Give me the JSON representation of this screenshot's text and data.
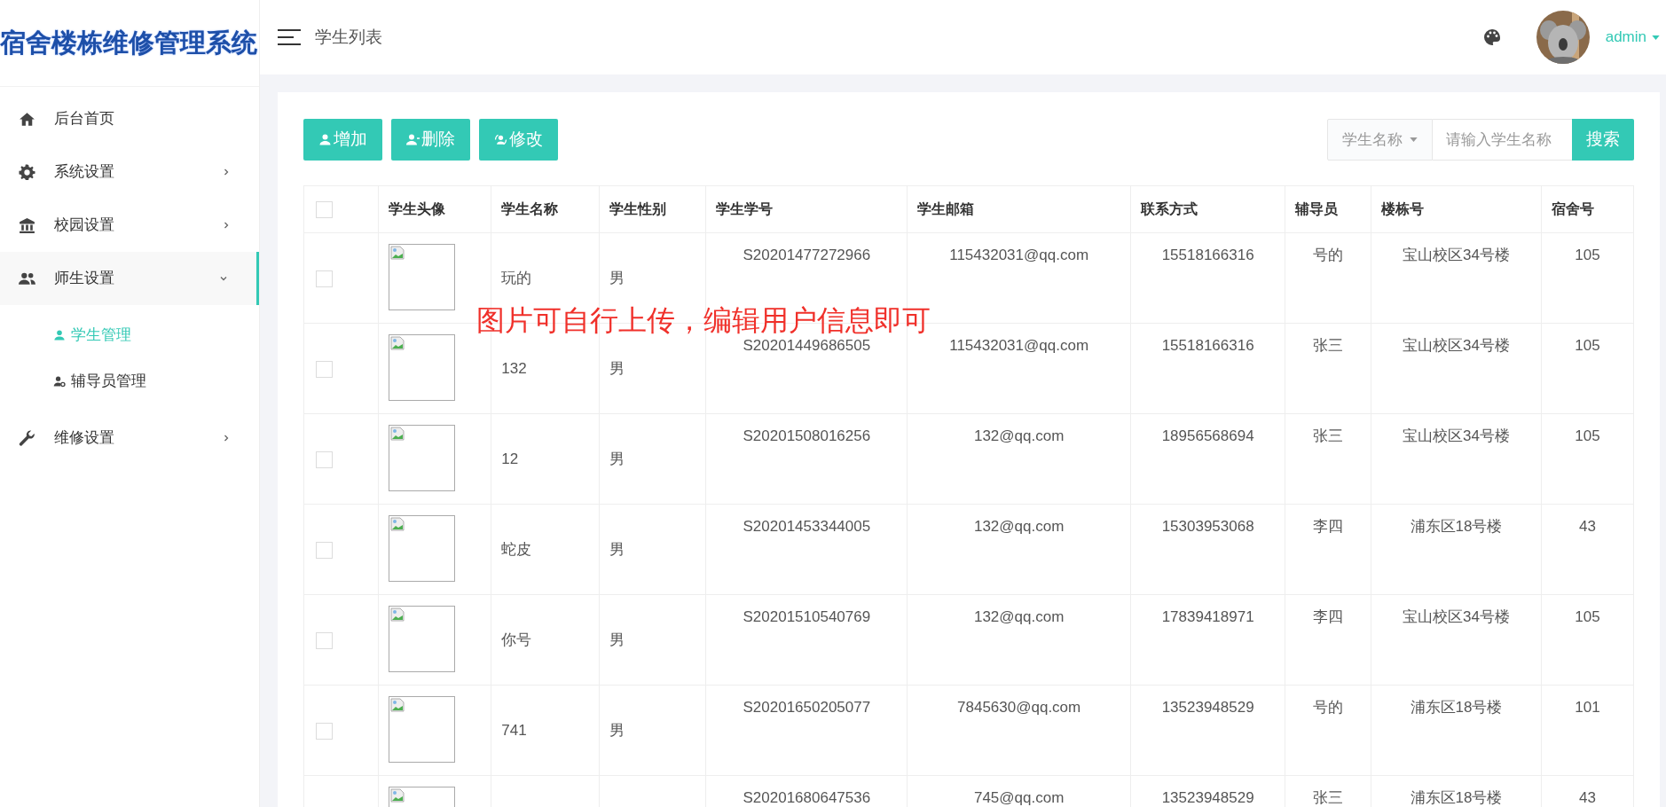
{
  "app_title": "宿舍楼栋维修管理系统",
  "header": {
    "page_title": "学生列表",
    "user": "admin"
  },
  "sidebar": {
    "items": [
      {
        "label": "后台首页",
        "expandable": false,
        "expanded": false
      },
      {
        "label": "系统设置",
        "expandable": true,
        "expanded": false
      },
      {
        "label": "校园设置",
        "expandable": true,
        "expanded": false
      },
      {
        "label": "师生设置",
        "expandable": true,
        "expanded": true,
        "children": [
          {
            "label": "学生管理",
            "selected": true
          },
          {
            "label": "辅导员管理",
            "selected": false
          }
        ]
      },
      {
        "label": "维修设置",
        "expandable": true,
        "expanded": false
      }
    ]
  },
  "toolbar": {
    "buttons": [
      {
        "label": "增加"
      },
      {
        "label": "删除"
      },
      {
        "label": "修改"
      }
    ],
    "search": {
      "filter": "学生名称",
      "placeholder": "请输入学生名称",
      "button": "搜索"
    }
  },
  "table": {
    "all_checked": false,
    "columns": [
      "学生头像",
      "学生名称",
      "学生性别",
      "学生学号",
      "学生邮箱",
      "联系方式",
      "辅导员",
      "楼栋号",
      "宿舍号"
    ],
    "rows": [
      {
        "checked": false,
        "name": "玩的",
        "gender": "男",
        "id": "S20201477272966",
        "email": "115432031@qq.com",
        "phone": "15518166316",
        "counselor": "号的",
        "building": "宝山校区34号楼",
        "room": "105"
      },
      {
        "checked": false,
        "name": "132",
        "gender": "男",
        "id": "S20201449686505",
        "email": "115432031@qq.com",
        "phone": "15518166316",
        "counselor": "张三",
        "building": "宝山校区34号楼",
        "room": "105"
      },
      {
        "checked": false,
        "name": "12",
        "gender": "男",
        "id": "S20201508016256",
        "email": "132@qq.com",
        "phone": "18956568694",
        "counselor": "张三",
        "building": "宝山校区34号楼",
        "room": "105"
      },
      {
        "checked": false,
        "name": "蛇皮",
        "gender": "男",
        "id": "S20201453344005",
        "email": "132@qq.com",
        "phone": "15303953068",
        "counselor": "李四",
        "building": "浦东区18号楼",
        "room": "43"
      },
      {
        "checked": false,
        "name": "你号",
        "gender": "男",
        "id": "S20201510540769",
        "email": "132@qq.com",
        "phone": "17839418971",
        "counselor": "李四",
        "building": "宝山校区34号楼",
        "room": "105"
      },
      {
        "checked": false,
        "name": "741",
        "gender": "男",
        "id": "S20201650205077",
        "email": "7845630@qq.com",
        "phone": "13523948529",
        "counselor": "号的",
        "building": "浦东区18号楼",
        "room": "101"
      },
      {
        "id": "S20201680647536",
        "email": "745@qq.com",
        "phone": "13523948529",
        "counselor": "张三",
        "building": "浦东区18号楼",
        "room": "43"
      }
    ]
  },
  "annotation": "图片可自行上传，编辑用户信息即可"
}
